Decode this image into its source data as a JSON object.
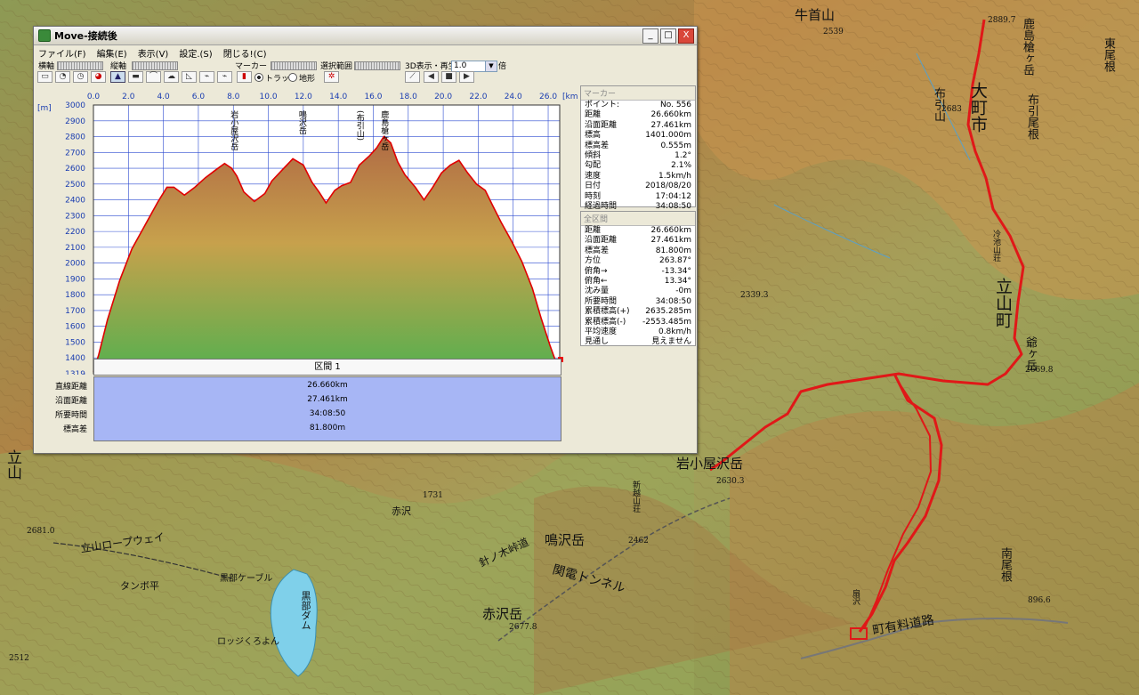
{
  "window": {
    "title": "Move-接続後",
    "buttons": {
      "minimize": "_",
      "maximize": "□",
      "close": "X"
    }
  },
  "menu": [
    "ファイル(F)",
    "編集(E)",
    "表示(V)",
    "設定.(S)",
    "閉じる!(C)"
  ],
  "toolbar": {
    "horizontal_axis": "横軸",
    "vertical_axis": "縦軸",
    "marker": "マーカー",
    "selection": "選択範囲",
    "playback": "3D表示・再生",
    "speed_value": "1.0",
    "speed_unit": "倍",
    "radio_track": "トラック",
    "radio_terrain": "地形",
    "play_controls": [
      "◀",
      "■",
      "▶"
    ]
  },
  "chart_data": {
    "type": "area",
    "xlabel": "[km]",
    "ylabel": "[m]",
    "x_ticks": [
      "0.0",
      "2.0",
      "4.0",
      "6.0",
      "8.0",
      "10.0",
      "12.0",
      "14.0",
      "16.0",
      "18.0",
      "20.0",
      "22.0",
      "24.0",
      "26.0"
    ],
    "y_ticks": [
      "1319",
      "1400",
      "1500",
      "1600",
      "1700",
      "1800",
      "1900",
      "2000",
      "2100",
      "2200",
      "2300",
      "2400",
      "2500",
      "2600",
      "2700",
      "2800",
      "2900",
      "3000"
    ],
    "xlim": [
      0,
      26.66
    ],
    "ylim": [
      1319,
      3000
    ],
    "x": [
      0,
      0.3,
      0.8,
      1.5,
      2.2,
      3.0,
      3.7,
      4.2,
      4.6,
      5.2,
      5.8,
      6.4,
      7.0,
      7.5,
      7.9,
      8.2,
      8.6,
      9.2,
      9.8,
      10.2,
      10.8,
      11.4,
      12.0,
      12.5,
      12.9,
      13.3,
      13.8,
      14.2,
      14.7,
      15.2,
      15.8,
      16.2,
      16.6,
      17.0,
      17.4,
      17.8,
      18.4,
      18.9,
      19.4,
      19.9,
      20.4,
      20.9,
      21.4,
      21.9,
      22.4,
      22.8,
      23.3,
      23.9,
      24.5,
      25.1,
      25.6,
      26.1,
      26.4,
      26.66
    ],
    "y": [
      1330,
      1420,
      1640,
      1890,
      2090,
      2250,
      2390,
      2480,
      2480,
      2430,
      2480,
      2540,
      2590,
      2630,
      2600,
      2550,
      2450,
      2390,
      2440,
      2520,
      2590,
      2660,
      2620,
      2510,
      2450,
      2380,
      2460,
      2490,
      2510,
      2620,
      2680,
      2730,
      2800,
      2760,
      2640,
      2560,
      2480,
      2400,
      2480,
      2570,
      2620,
      2650,
      2570,
      2500,
      2460,
      2370,
      2260,
      2140,
      2010,
      1840,
      1650,
      1480,
      1390,
      1319
    ],
    "peak_labels": [
      {
        "text": "岩小屋沢岳",
        "x": 8.0
      },
      {
        "text": "鳴沢岳",
        "x": 11.9
      },
      {
        "text": "(布引山)",
        "x": 15.2
      },
      {
        "text": "鹿島槍ヶ岳",
        "x": 16.6
      }
    ],
    "fill_colors": {
      "top": "#b06a44",
      "middle": "#c7a14c",
      "bottom": "#55b04e"
    },
    "line_color": "#e00000",
    "grid_color": "#2c4bd0"
  },
  "marker_panel": {
    "header": "マーカー",
    "rows": [
      {
        "label": "ポイント:",
        "value": "No. 556"
      },
      {
        "label": "距離",
        "value": "26.660km"
      },
      {
        "label": "沿面距離",
        "value": "27.461km"
      },
      {
        "label": "標高",
        "value": "1401.000m"
      },
      {
        "label": "標高差",
        "value": "0.555m"
      },
      {
        "label": "傾斜",
        "value": "1.2°"
      },
      {
        "label": "勾配",
        "value": "2.1%"
      },
      {
        "label": "速度",
        "value": "1.5km/h"
      },
      {
        "label": "日付",
        "value": "2018/08/20"
      },
      {
        "label": "時刻",
        "value": "17:04:12"
      },
      {
        "label": "経過時間",
        "value": "34:08:50"
      }
    ]
  },
  "total_panel": {
    "header": "全区間",
    "rows": [
      {
        "label": "距離",
        "value": "26.660km"
      },
      {
        "label": "沿面距離",
        "value": "27.461km"
      },
      {
        "label": "標高差",
        "value": "81.800m"
      },
      {
        "label": "方位",
        "value": "263.87°"
      },
      {
        "label": "俯角→",
        "value": "-13.34°"
      },
      {
        "label": "俯角←",
        "value": "13.34°"
      },
      {
        "label": "沈み量",
        "value": "-0m"
      },
      {
        "label": "所要時間",
        "value": "34:08:50"
      },
      {
        "label": "累積標高(+)",
        "value": "2635.285m"
      },
      {
        "label": "累積標高(-)",
        "value": "-2553.485m"
      },
      {
        "label": "平均速度",
        "value": "0.8km/h"
      },
      {
        "label": "見通し",
        "value": "見えません"
      }
    ]
  },
  "section": {
    "title": "区間 1",
    "labels": [
      "直線距離",
      "沿面距離",
      "所要時間",
      "標高差"
    ],
    "values": [
      "26.660km",
      "27.461km",
      "34:08:50",
      "81.800m"
    ]
  },
  "map_labels": {
    "ushikubi": "牛首山",
    "ushikubi_elev": "2539",
    "kashimayari_north": "鹿島槍ヶ岳",
    "summit_elev": "2889.7",
    "omachi": "大町市",
    "nunobiki": "布引山",
    "nunobiki_elev": "2683",
    "nunobiki_ridge": "布引尾根",
    "higashi_ridge": "東尾根",
    "reiho": "冷池山荘",
    "tateyama_town": "立山町",
    "tsubakuro": "爺ヶ岳",
    "tsubakuro_elev": "2669.8",
    "iwagoya": "岩小屋沢岳",
    "iwagoya_elev": "2630.3",
    "narusawa": "鳴沢岳",
    "narusawa_elev": "2462",
    "shinkoshi": "新越山荘",
    "akazawa": "赤沢岳",
    "akazawa_elev": "2677.8",
    "ropeway": "立山ロープウェイ",
    "kurobe_cable": "黒部ケーブル",
    "tanbo": "タンボ平",
    "kurobe_dam": "黒部ダム",
    "tunnel": "関電トンネル",
    "harinoki": "針ノ木峠道",
    "toll_road": "町有料道路",
    "ogizawa": "扇沢",
    "elev_2339": "2339.3",
    "elev_1731": "1731",
    "elev_2681": "2681.0",
    "elev_2512": "2512",
    "elev_896": "896.6",
    "tateyama_left": "立山",
    "akazawa_stream": "赤沢",
    "minami_ridge": "南尾根",
    "lodge": "ロッジくろよん"
  }
}
